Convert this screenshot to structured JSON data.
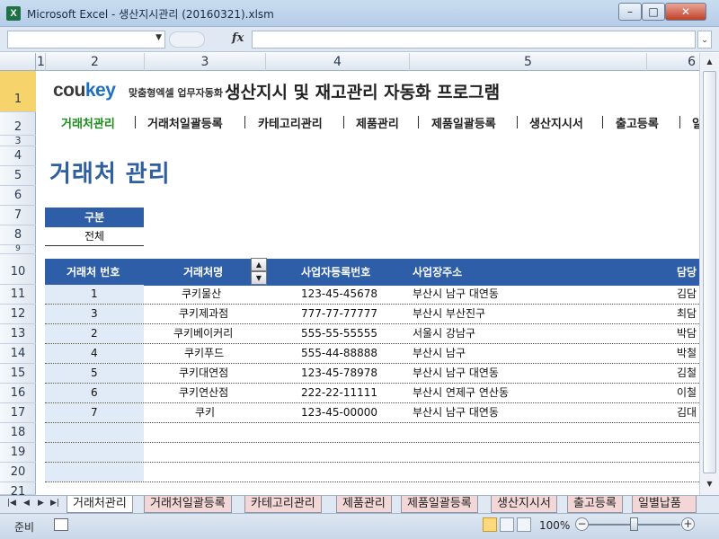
{
  "window": {
    "title": "Microsoft Excel - 생산지시관리 (20160321).xlsm",
    "app_icon": "X"
  },
  "formula_bar": {
    "name_box": "",
    "fx_label": "fx",
    "content": ""
  },
  "columns": [
    "1",
    "2",
    "3",
    "4",
    "5",
    "6"
  ],
  "rows": [
    "1",
    "2",
    "3",
    "4",
    "5",
    "6",
    "7",
    "8",
    "9",
    "10",
    "11",
    "12",
    "13",
    "14",
    "15",
    "16",
    "17",
    "18",
    "19",
    "20",
    "21"
  ],
  "brand": {
    "name_prefix": "cou",
    "name_suffix": "key",
    "tagline": "맞춤형엑셀 업무자동화"
  },
  "app_title": "생산지시 및 재고관리 자동화 프로그램",
  "menu": [
    "거래처관리",
    "거래처일괄등록",
    "카테고리관리",
    "제품관리",
    "제품일괄등록",
    "생산지시서",
    "출고등록",
    "일"
  ],
  "page_title": "거래처 관리",
  "filter": {
    "header": "구분",
    "value": "전체"
  },
  "table": {
    "headers": [
      "거래처 번호",
      "거래처명",
      "사업자등록번호",
      "사업장주소",
      "담당"
    ],
    "rows": [
      [
        "1",
        "쿠키물산",
        "123-45-45678",
        "부산시 남구 대연동",
        "김담"
      ],
      [
        "3",
        "쿠키제과점",
        "777-77-77777",
        "부산시 부산진구",
        "최담"
      ],
      [
        "2",
        "쿠키베이커리",
        "555-55-55555",
        "서울시 강남구",
        "박담"
      ],
      [
        "4",
        "쿠키푸드",
        "555-44-88888",
        "부산시 남구",
        "박철"
      ],
      [
        "5",
        "쿠키대연점",
        "123-45-78978",
        "부산시 남구 대연동",
        "김철"
      ],
      [
        "6",
        "쿠키연산점",
        "222-22-11111",
        "부산시 연제구 연산동",
        "이철"
      ],
      [
        "7",
        "쿠키",
        "123-45-00000",
        "부산시 남구 대연동",
        "김대"
      ],
      [
        "",
        "",
        "",
        "",
        ""
      ],
      [
        "",
        "",
        "",
        "",
        ""
      ],
      [
        "",
        "",
        "",
        "",
        ""
      ]
    ]
  },
  "sheet_tabs": [
    "거래처관리",
    "거래처일괄등록",
    "카테고리관리",
    "제품관리",
    "제품일괄등록",
    "생산지시서",
    "출고등록",
    "일별납품"
  ],
  "status": {
    "ready": "준비",
    "zoom": "100%"
  },
  "colors": {
    "header_blue": "#2e5ea8",
    "title_blue": "#2f5f9f",
    "active_menu": "#1a8b1a",
    "number_col": "#e1ebf7"
  }
}
